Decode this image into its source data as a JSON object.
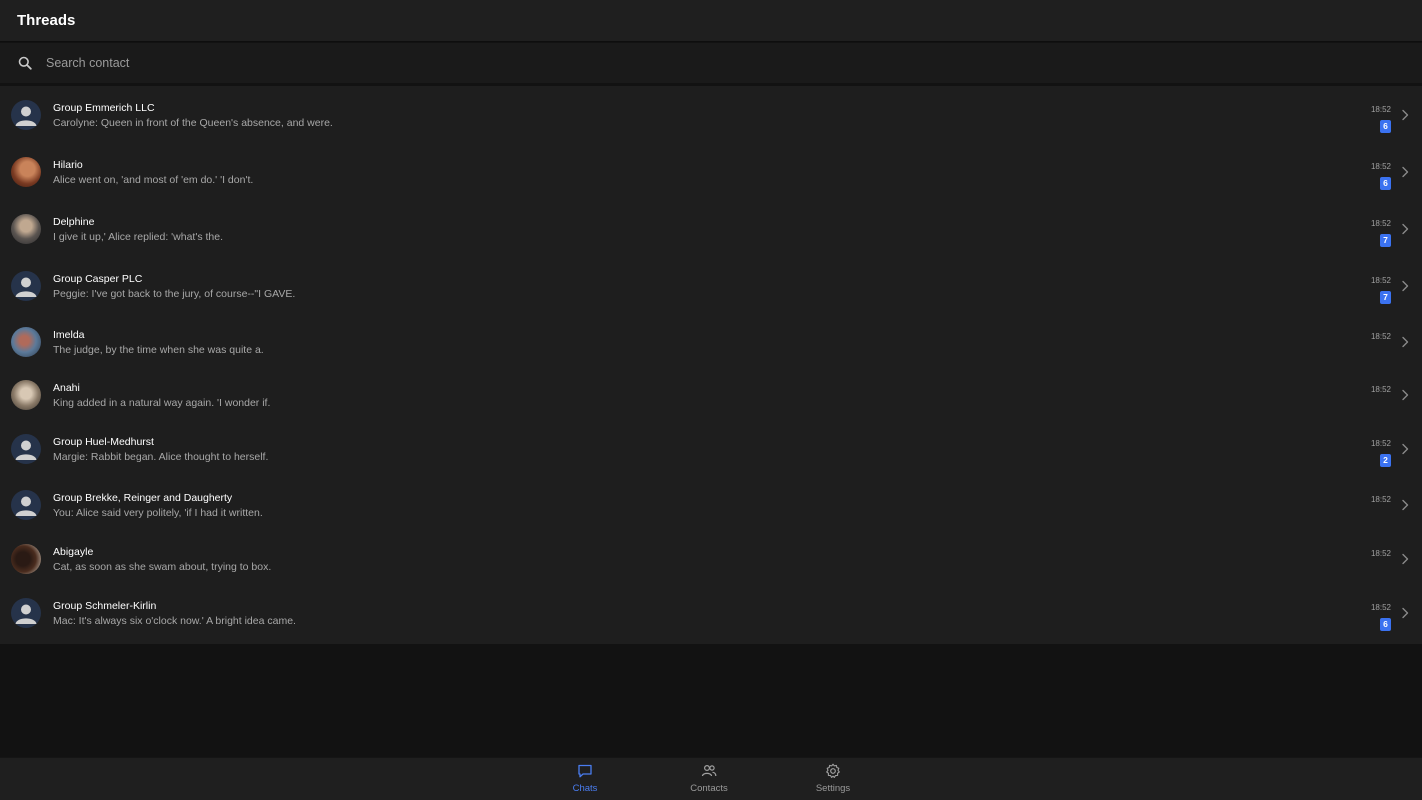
{
  "header": {
    "title": "Threads"
  },
  "search": {
    "placeholder": "Search contact",
    "value": ""
  },
  "threads": [
    {
      "name": "Group Emmerich LLC",
      "preview": "Carolyne: Queen in front of the Queen's absence, and were.",
      "time": "18:52",
      "badge": "6",
      "avatar": "generic"
    },
    {
      "name": "Hilario",
      "preview": "Alice went on, 'and most of 'em do.' 'I don't.",
      "time": "18:52",
      "badge": "6",
      "avatar": "photo"
    },
    {
      "name": "Delphine",
      "preview": "I give it up,' Alice replied: 'what's the.",
      "time": "18:52",
      "badge": "7",
      "avatar": "photo"
    },
    {
      "name": "Group Casper PLC",
      "preview": "Peggie: I've got back to the jury, of course--\"I GAVE.",
      "time": "18:52",
      "badge": "7",
      "avatar": "generic"
    },
    {
      "name": "Imelda",
      "preview": "The judge, by the time when she was quite a.",
      "time": "18:52",
      "badge": "",
      "avatar": "photo"
    },
    {
      "name": "Anahi",
      "preview": "King added in a natural way again. 'I wonder if.",
      "time": "18:52",
      "badge": "",
      "avatar": "photo"
    },
    {
      "name": "Group Huel-Medhurst",
      "preview": "Margie: Rabbit began. Alice thought to herself.",
      "time": "18:52",
      "badge": "2",
      "avatar": "generic"
    },
    {
      "name": "Group Brekke, Reinger and Daugherty",
      "preview": "You: Alice said very politely, 'if I had it written.",
      "time": "18:52",
      "badge": "",
      "avatar": "generic"
    },
    {
      "name": "Abigayle",
      "preview": "Cat, as soon as she swam about, trying to box.",
      "time": "18:52",
      "badge": "",
      "avatar": "photo"
    },
    {
      "name": "Group Schmeler-Kirlin",
      "preview": "Mac: It's always six o'clock now.' A bright idea came.",
      "time": "18:52",
      "badge": "6",
      "avatar": "generic"
    }
  ],
  "tabs": [
    {
      "label": "Chats",
      "icon": "chat-bubble-icon",
      "active": true
    },
    {
      "label": "Contacts",
      "icon": "people-icon",
      "active": false
    },
    {
      "label": "Settings",
      "icon": "gear-icon",
      "active": false
    }
  ],
  "colors": {
    "accent": "#3b72f0",
    "background": "#121212",
    "surface": "#1e1e1e"
  }
}
